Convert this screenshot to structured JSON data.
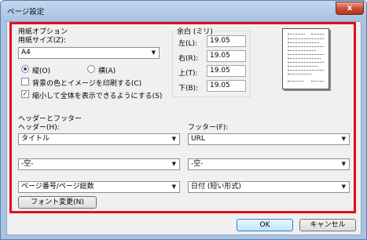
{
  "window": {
    "title": "ページ設定",
    "close_glyph": "x"
  },
  "paper": {
    "group_title": "用紙オプション",
    "size_label": "用紙サイズ(Z):",
    "size_value": "A4",
    "orientation_portrait": "縦(O)",
    "orientation_landscape": "横(A)",
    "orientation_selected": "portrait",
    "print_background_label": "背景の色とイメージを印刷する(C)",
    "print_background_checked": false,
    "shrink_to_fit_label": "縮小して全体を表示できるようにする(S)",
    "shrink_to_fit_checked": true
  },
  "margins": {
    "group_title": "余白 (ミリ)",
    "left_label": "左(L):",
    "left_value": "19.05",
    "right_label": "右(R):",
    "right_value": "19.05",
    "top_label": "上(T):",
    "top_value": "19.05",
    "bottom_label": "下(B):",
    "bottom_value": "19.05"
  },
  "header_footer": {
    "group_title": "ヘッダーとフッター",
    "header_label": "ヘッダー(H):",
    "footer_label": "フッター(F):",
    "header_1": "タイトル",
    "header_2": "-空-",
    "header_3": "ページ番号/ページ総数",
    "footer_1": "URL",
    "footer_2": "-空-",
    "footer_3": "日付 (短い形式)",
    "font_button": "フォント変更(N)"
  },
  "buttons": {
    "ok": "OK",
    "cancel": "キャンセル"
  },
  "colors": {
    "highlight_frame": "#e0101e",
    "title_bar": "#a6c2e3"
  }
}
